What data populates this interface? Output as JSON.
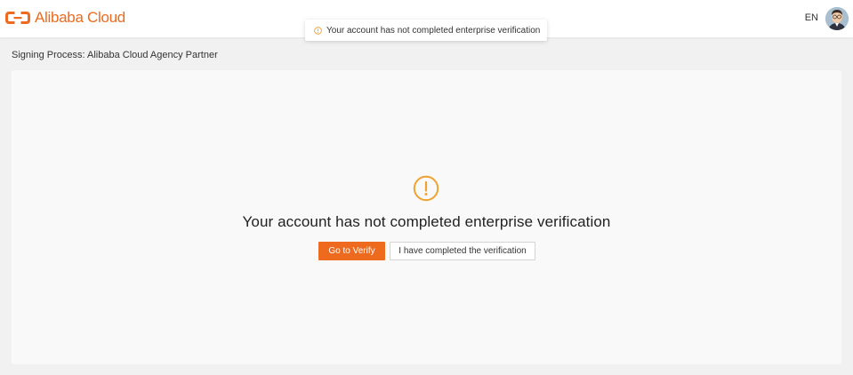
{
  "header": {
    "logo_text": "Alibaba Cloud",
    "language": "EN",
    "brand_color": "#ED6A1E"
  },
  "toast": {
    "icon": "warning-circle-icon",
    "message": "Your account has not completed enterprise verification"
  },
  "breadcrumb": {
    "title": "Signing Process: Alibaba Cloud Agency Partner"
  },
  "result": {
    "icon": "warning-circle-icon",
    "icon_color": "#F0A22E",
    "title": "Your account has not completed enterprise verification",
    "primary_button": "Go to Verify",
    "secondary_button": "I have completed the verification"
  }
}
